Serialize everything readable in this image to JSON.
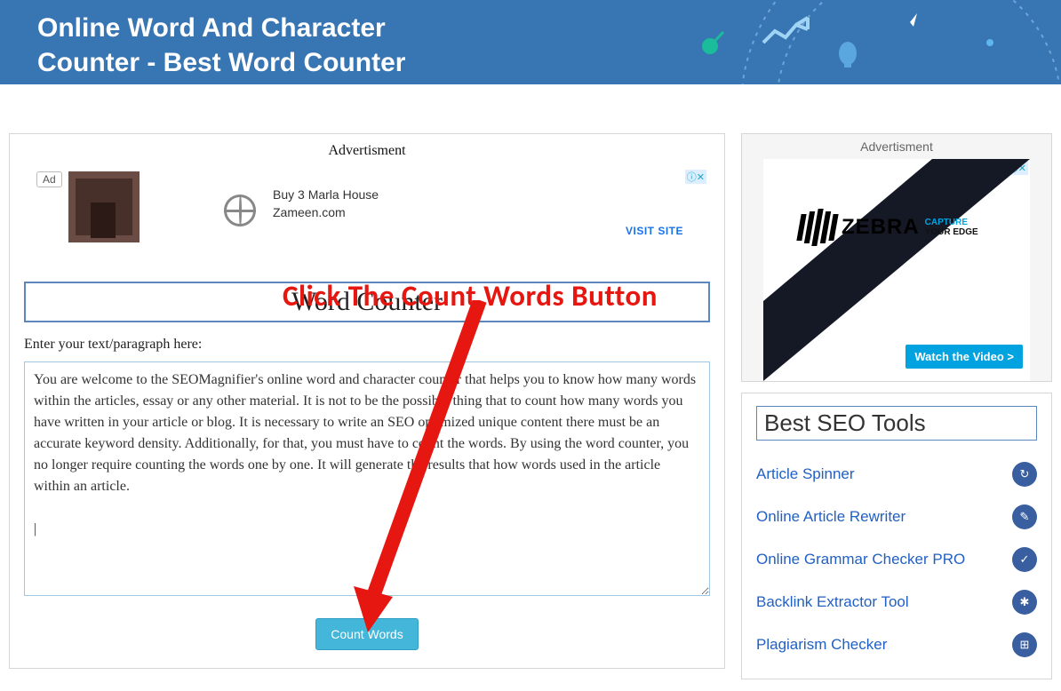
{
  "header": {
    "title": "Online Word And Character Counter - Best Word Counter"
  },
  "main": {
    "ad_label": "Advertisment",
    "ad": {
      "badge": "Ad",
      "line1": "Buy 3 Marla House",
      "line2": "Zameen.com",
      "visit": "VISIT SITE",
      "info": "ⓘ✕"
    },
    "tool_title": "Word Counter",
    "input_label": "Enter your text/paragraph here:",
    "textarea_value": "You are welcome to the SEOMagnifier's online word and character counter that helps you to know how many words within the articles, essay or any other material. It is not to be the possible thing that to count how many words you have written in your article or blog. It is necessary to write an SEO optimized unique content there must be an accurate keyword density. Additionally, for that, you must have to count the words. By using the word counter, you no longer require counting the words one by one. It will generate the results that how words used in the article within an article.\n\n|",
    "count_button": "Count Words"
  },
  "annotation": {
    "text": "Click The Count Words Button"
  },
  "sidebar": {
    "ad_label": "Advertisment",
    "ad": {
      "brand": "ZEBRA",
      "tag1": "CAPTURE",
      "tag2": "YOUR EDGE",
      "cta": "Watch the Video >",
      "info": "ⓘ✕"
    },
    "tools_title": "Best SEO Tools",
    "tools": [
      {
        "label": "Article Spinner",
        "icon": "↻"
      },
      {
        "label": "Online Article Rewriter",
        "icon": "✎"
      },
      {
        "label": "Online Grammar Checker PRO",
        "icon": "✓"
      },
      {
        "label": "Backlink Extractor Tool",
        "icon": "✱"
      },
      {
        "label": "Plagiarism Checker",
        "icon": "⊞"
      }
    ]
  }
}
